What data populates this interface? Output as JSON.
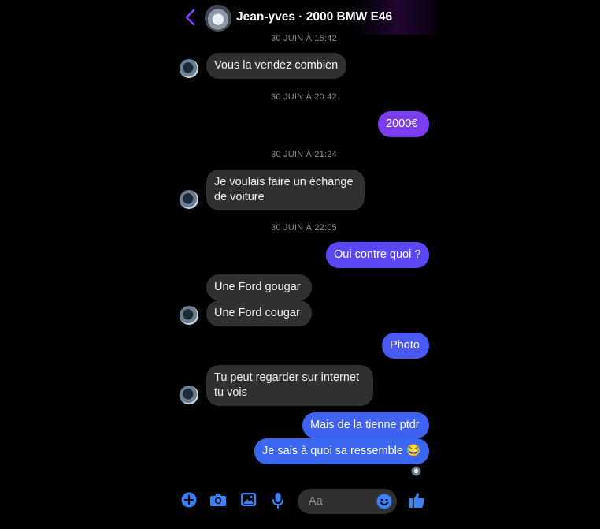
{
  "header": {
    "title": "Jean-yves · 2000 BMW E46",
    "back_icon": "chevron-left-icon",
    "accent": "#8b3dff"
  },
  "timestamps": [
    "30 JUIN À 15:42",
    "30 JUIN À 20:42",
    "30 JUIN À 21:24",
    "30 JUIN À 22:05"
  ],
  "messages": [
    {
      "from": "them",
      "text": "Vous la vendez combien"
    },
    {
      "from": "me",
      "text": "2000€",
      "color": "#7b3ff0"
    },
    {
      "from": "them",
      "text": "Je voulais faire un échange de voiture"
    },
    {
      "from": "me",
      "text": "Oui contre quoi ?",
      "color": "#5a47f5"
    },
    {
      "from": "them",
      "text": "Une Ford  gougar"
    },
    {
      "from": "them",
      "text": "Une Ford  cougar"
    },
    {
      "from": "me",
      "text": "Photo",
      "color": "#4a5bf5"
    },
    {
      "from": "them",
      "text": "Tu peut regarder sur internet tu vois"
    },
    {
      "from": "me",
      "text": "Mais de la tienne ptdr",
      "color": "#3f62f2"
    },
    {
      "from": "me",
      "text": "Je sais à quoi sa ressemble 😂",
      "color": "#3b66f0"
    }
  ],
  "composer": {
    "placeholder": "Aa",
    "icons": [
      "plus-circle-icon",
      "camera-icon",
      "image-icon",
      "microphone-icon",
      "emoji-icon",
      "thumbs-up-icon"
    ],
    "icon_color": "#3b82f6"
  }
}
